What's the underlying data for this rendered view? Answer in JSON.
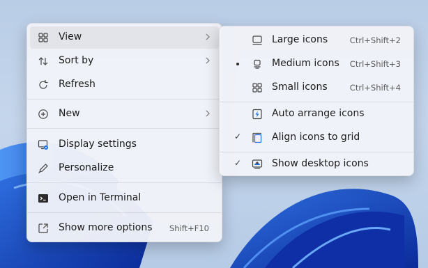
{
  "context_menu": {
    "items": [
      {
        "label": "View",
        "icon": "grid-icon",
        "has_submenu": true
      },
      {
        "label": "Sort by",
        "icon": "sort-icon",
        "has_submenu": true
      },
      {
        "label": "Refresh",
        "icon": "refresh-icon"
      },
      {
        "label": "New",
        "icon": "plus-circle-icon",
        "has_submenu": true
      },
      {
        "label": "Display settings",
        "icon": "display-settings-icon"
      },
      {
        "label": "Personalize",
        "icon": "pen-icon"
      },
      {
        "label": "Open in Terminal",
        "icon": "terminal-icon"
      },
      {
        "label": "Show more options",
        "icon": "share-icon",
        "shortcut": "Shift+F10"
      }
    ]
  },
  "view_submenu": {
    "items": [
      {
        "label": "Large icons",
        "icon": "large-icons-icon",
        "shortcut": "Ctrl+Shift+2",
        "selected": false
      },
      {
        "label": "Medium icons",
        "icon": "medium-icons-icon",
        "shortcut": "Ctrl+Shift+3",
        "selected": true
      },
      {
        "label": "Small icons",
        "icon": "small-icons-icon",
        "shortcut": "Ctrl+Shift+4",
        "selected": false
      },
      {
        "label": "Auto arrange icons",
        "icon": "auto-arrange-icon",
        "checked": false
      },
      {
        "label": "Align icons to grid",
        "icon": "align-grid-icon",
        "checked": true
      },
      {
        "label": "Show desktop icons",
        "icon": "show-desktop-icon",
        "checked": true
      }
    ],
    "check_glyph": "✓"
  },
  "colors": {
    "accent": "#1d6ee4",
    "menu_background": "#f0f3f8",
    "desktop_background": "#c5d6ec"
  }
}
